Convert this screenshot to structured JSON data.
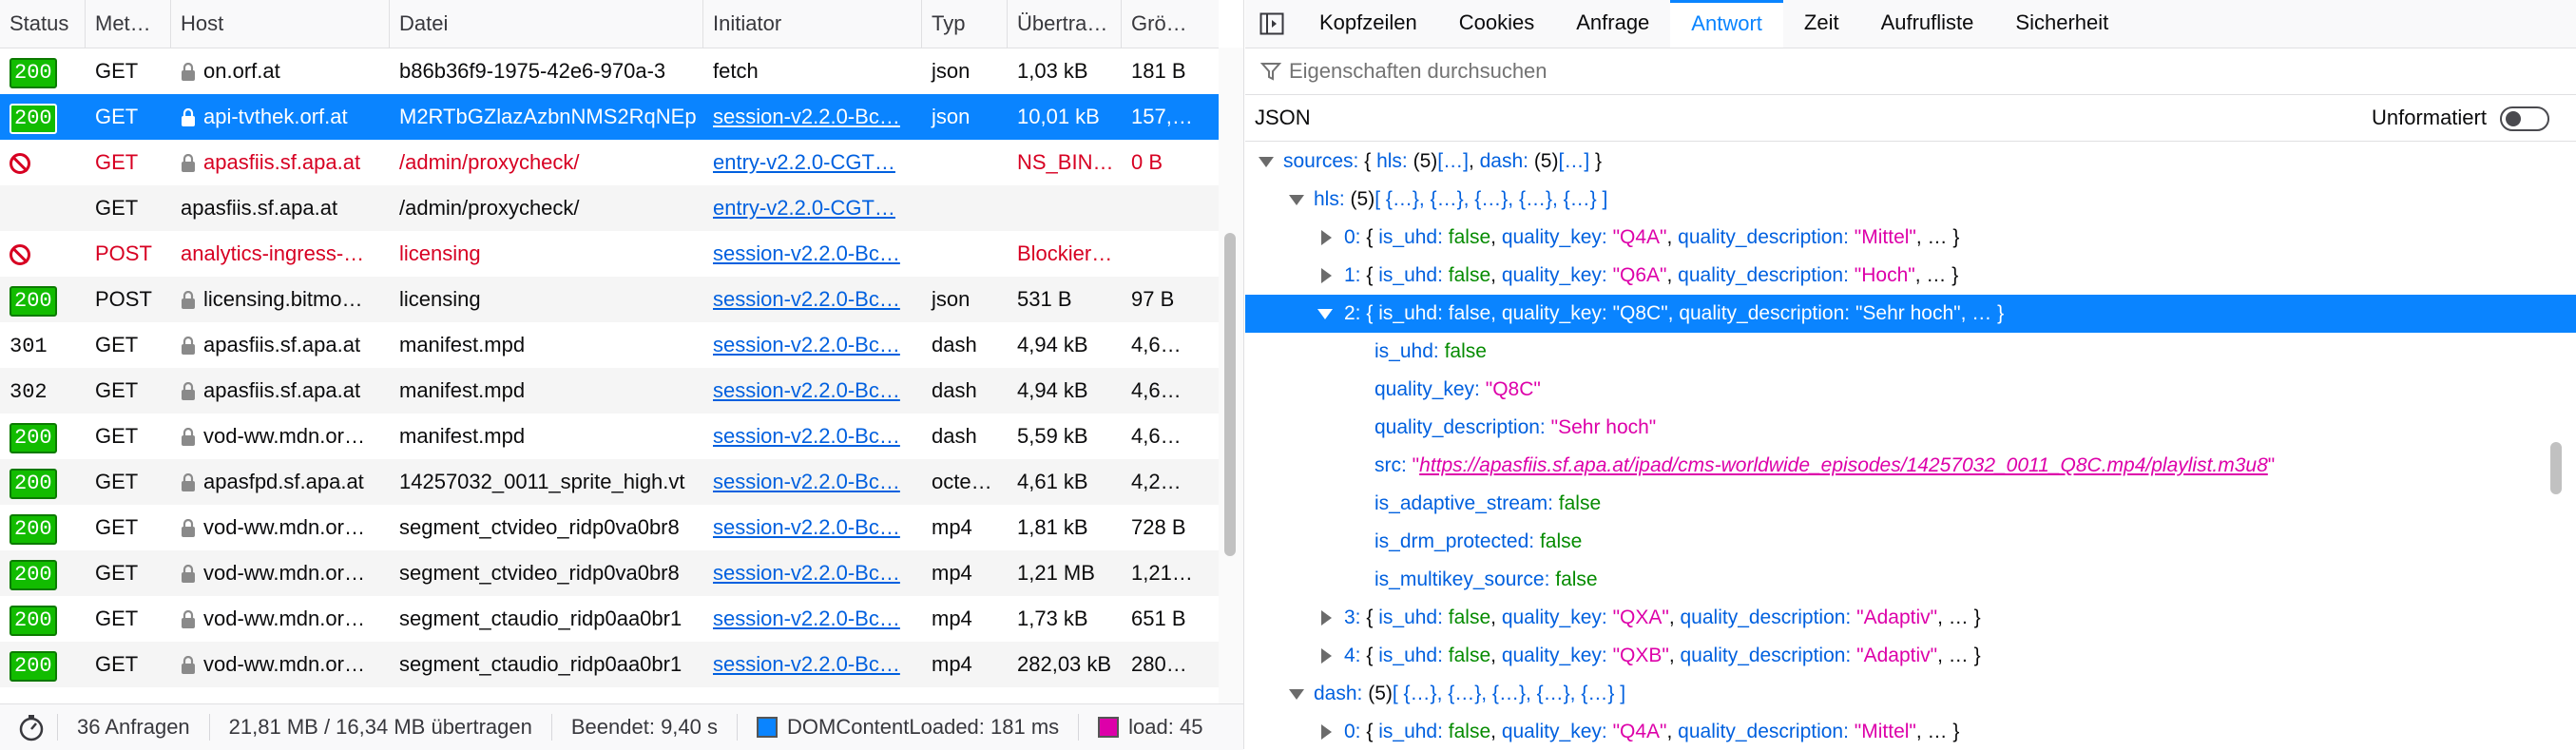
{
  "network": {
    "columns": [
      "Status",
      "Met…",
      "Host",
      "Datei",
      "Initiator",
      "Typ",
      "Übertra…",
      "Grö…"
    ],
    "rows": [
      {
        "status": "200",
        "method": "GET",
        "host": "on.orf.at",
        "file": "b86b36f9-1975-42e6-970a-3",
        "initiator": "fetch",
        "type": "json",
        "transferred": "1,03 kB",
        "size": "181 B",
        "secure": true,
        "kind": "ok"
      },
      {
        "status": "200",
        "method": "GET",
        "host": "api-tvthek.orf.at",
        "file": "M2RTbGZlazAzbnNMS2RqNEp",
        "initiator": "session-v2.2.0-Bc…",
        "type": "json",
        "transferred": "10,01 kB",
        "size": "157,…",
        "secure": true,
        "kind": "selected"
      },
      {
        "status": "",
        "method": "GET",
        "host": "apasfiis.sf.apa.at",
        "file": "/admin/proxycheck/",
        "initiator": "entry-v2.2.0-CGT…",
        "type": "",
        "transferred": "NS_BIN…",
        "size": "0 B",
        "secure": true,
        "kind": "blocked"
      },
      {
        "status": "",
        "method": "GET",
        "host": "apasfiis.sf.apa.at",
        "file": "/admin/proxycheck/",
        "initiator": "entry-v2.2.0-CGT…",
        "type": "",
        "transferred": "",
        "size": "",
        "secure": false,
        "kind": "none"
      },
      {
        "status": "",
        "method": "POST",
        "host": "analytics-ingress-…",
        "file": "licensing",
        "initiator": "session-v2.2.0-Bc…",
        "type": "",
        "transferred": "Blockier…",
        "size": "",
        "secure": false,
        "kind": "blocked"
      },
      {
        "status": "200",
        "method": "POST",
        "host": "licensing.bitmo…",
        "file": "licensing",
        "initiator": "session-v2.2.0-Bc…",
        "type": "json",
        "transferred": "531 B",
        "size": "97 B",
        "secure": true,
        "kind": "ok"
      },
      {
        "status": "301",
        "method": "GET",
        "host": "apasfiis.sf.apa.at",
        "file": "manifest.mpd",
        "initiator": "session-v2.2.0-Bc…",
        "type": "dash",
        "transferred": "4,94 kB",
        "size": "4,6…",
        "secure": true,
        "kind": "redirect"
      },
      {
        "status": "302",
        "method": "GET",
        "host": "apasfiis.sf.apa.at",
        "file": "manifest.mpd",
        "initiator": "session-v2.2.0-Bc…",
        "type": "dash",
        "transferred": "4,94 kB",
        "size": "4,6…",
        "secure": true,
        "kind": "redirect"
      },
      {
        "status": "200",
        "method": "GET",
        "host": "vod-ww.mdn.or…",
        "file": "manifest.mpd",
        "initiator": "session-v2.2.0-Bc…",
        "type": "dash",
        "transferred": "5,59 kB",
        "size": "4,6…",
        "secure": true,
        "kind": "ok"
      },
      {
        "status": "200",
        "method": "GET",
        "host": "apasfpd.sf.apa.at",
        "file": "14257032_0011_sprite_high.vt",
        "initiator": "session-v2.2.0-Bc…",
        "type": "octe…",
        "transferred": "4,61 kB",
        "size": "4,2…",
        "secure": true,
        "kind": "ok"
      },
      {
        "status": "200",
        "method": "GET",
        "host": "vod-ww.mdn.or…",
        "file": "segment_ctvideo_ridp0va0br8",
        "initiator": "session-v2.2.0-Bc…",
        "type": "mp4",
        "transferred": "1,81 kB",
        "size": "728 B",
        "secure": true,
        "kind": "ok"
      },
      {
        "status": "200",
        "method": "GET",
        "host": "vod-ww.mdn.or…",
        "file": "segment_ctvideo_ridp0va0br8",
        "initiator": "session-v2.2.0-Bc…",
        "type": "mp4",
        "transferred": "1,21 MB",
        "size": "1,21…",
        "secure": true,
        "kind": "ok"
      },
      {
        "status": "200",
        "method": "GET",
        "host": "vod-ww.mdn.or…",
        "file": "segment_ctaudio_ridp0aa0br1",
        "initiator": "session-v2.2.0-Bc…",
        "type": "mp4",
        "transferred": "1,73 kB",
        "size": "651 B",
        "secure": true,
        "kind": "ok"
      },
      {
        "status": "200",
        "method": "GET",
        "host": "vod-ww.mdn.or…",
        "file": "segment_ctaudio_ridp0aa0br1",
        "initiator": "session-v2.2.0-Bc…",
        "type": "mp4",
        "transferred": "282,03 kB",
        "size": "280…",
        "secure": true,
        "kind": "ok"
      }
    ],
    "statusbar": {
      "requests": "36 Anfragen",
      "transferred": "21,81 MB / 16,34 MB übertragen",
      "finished": "Beendet: 9,40 s",
      "dcl": "DOMContentLoaded: 181 ms",
      "load": "load: 45",
      "dcl_color": "#0a84ff",
      "load_color": "#dd00a9"
    }
  },
  "details": {
    "tabs": [
      "Kopfzeilen",
      "Cookies",
      "Anfrage",
      "Antwort",
      "Zeit",
      "Aufrufliste",
      "Sicherheit"
    ],
    "active_tab": "Antwort",
    "filter_placeholder": "Eigenschaften durchsuchen",
    "json_label": "JSON",
    "raw_label": "Unformatiert",
    "tree": {
      "sources": {
        "key": "sources:",
        "open": "{ ",
        "k1": "hls:",
        "c1": " (5)",
        "v1": "[…]",
        ",": ", ",
        "k2": "dash:",
        "c2": " (5)",
        "v2": "[…]",
        "close": " }"
      },
      "hls": {
        "key": "hls:",
        "count": " (5)",
        "items": "[ {…}, {…}, {…}, {…}, {…} ]"
      },
      "h0": {
        "idx": "0:",
        "uhd": "false",
        "qk": "\"Q4A\"",
        "qd": "\"Mittel\""
      },
      "h1": {
        "idx": "1:",
        "uhd": "false",
        "qk": "\"Q6A\"",
        "qd": "\"Hoch\""
      },
      "h2": {
        "idx": "2:",
        "uhd": "false",
        "qk": "\"Q8C\"",
        "qd": "\"Sehr hoch\""
      },
      "h2props": {
        "is_uhd": "false",
        "quality_key": "\"Q8C\"",
        "quality_description": "\"Sehr hoch\"",
        "src": "https://apasfiis.sf.apa.at/ipad/cms-worldwide_episodes/14257032_0011_Q8C.mp4/playlist.m3u8",
        "is_adaptive_stream": "false",
        "is_drm_protected": "false",
        "is_multikey_source": "false"
      },
      "h3": {
        "idx": "3:",
        "uhd": "false",
        "qk": "\"QXA\"",
        "qd": "\"Adaptiv\""
      },
      "h4": {
        "idx": "4:",
        "uhd": "false",
        "qk": "\"QXB\"",
        "qd": "\"Adaptiv\""
      },
      "dash": {
        "key": "dash:",
        "count": " (5)",
        "items": "[ {…}, {…}, {…}, {…}, {…} ]"
      },
      "d0": {
        "idx": "0:",
        "uhd": "false",
        "qk": "\"Q4A\"",
        "qd": "\"Mittel\""
      }
    },
    "labels": {
      "is_uhd": "is_uhd:",
      "quality_key": "quality_key:",
      "quality_description": "quality_description:",
      "src": "src:",
      "is_adaptive_stream": "is_adaptive_stream:",
      "is_drm_protected": "is_drm_protected:",
      "is_multikey_source": "is_multikey_source:",
      "ellipsis": ", … }",
      "open": "{ ",
      "comma": ", "
    }
  }
}
